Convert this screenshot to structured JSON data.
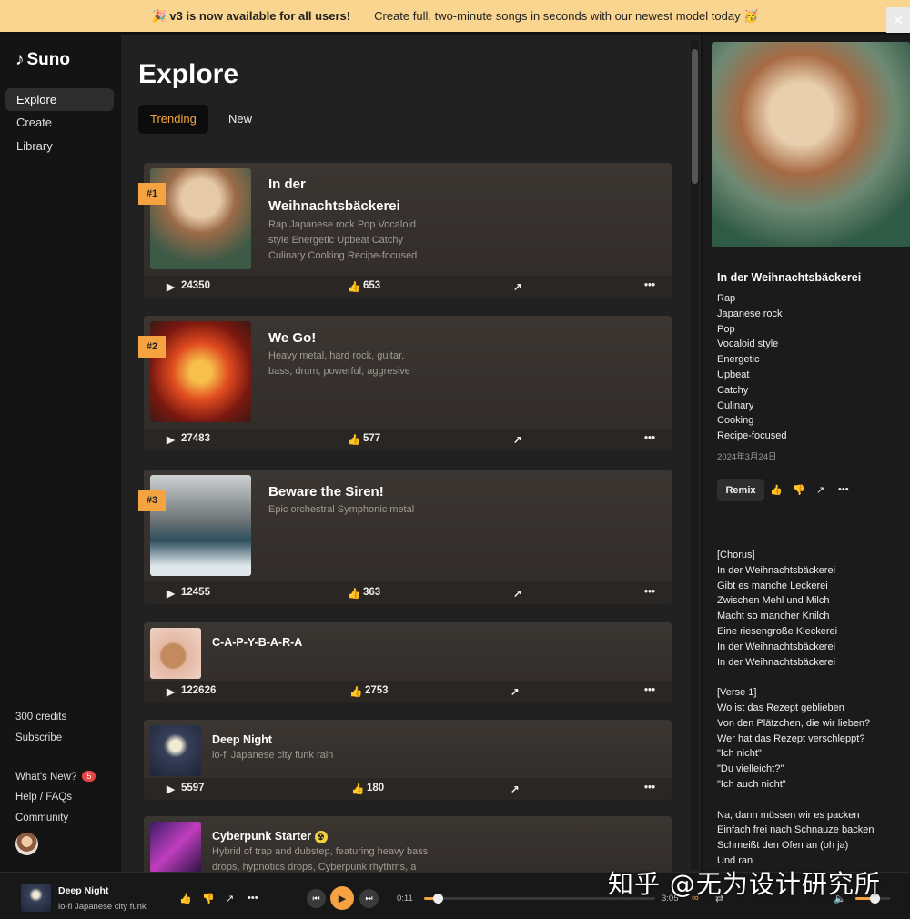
{
  "banner": {
    "headline": "v3 is now available for all users!",
    "text": "Create full, two-minute songs in seconds with our newest model today",
    "close": "✕"
  },
  "sidebar": {
    "logo": "Suno",
    "items": [
      {
        "label": "Explore",
        "active": true
      },
      {
        "label": "Create"
      },
      {
        "label": "Library"
      }
    ],
    "credits": "300 credits",
    "subscribe": "Subscribe",
    "whats_new": "What's New?",
    "whats_new_count": "5",
    "help": "Help / FAQs",
    "community": "Community"
  },
  "main": {
    "title": "Explore",
    "tabs": [
      "Trending",
      "New"
    ],
    "songs": [
      {
        "rank": "#1",
        "title": "In der Weihnachtsbäckerei",
        "desc": "Rap Japanese rock Pop Vocaloid style Energetic Upbeat Catchy Culinary Cooking Recipe-focused",
        "plays": "24350",
        "likes": "653"
      },
      {
        "rank": "#2",
        "title": "We Go!",
        "desc": "Heavy metal, hard rock, guitar, bass, drum, powerful, aggresive",
        "plays": "27483",
        "likes": "577"
      },
      {
        "rank": "#3",
        "title": "Beware the Siren!",
        "desc": "Epic orchestral Symphonic metal",
        "plays": "12455",
        "likes": "363"
      },
      {
        "title": "C-A-P-Y-B-A-R-A",
        "desc": "",
        "plays": "122626",
        "likes": "2753"
      },
      {
        "title": "Deep Night",
        "desc": "lo-fi Japanese city funk rain",
        "plays": "5597",
        "likes": "180"
      },
      {
        "title": "Cyberpunk Starter",
        "desc": "Hybrid of trap and dubstep, featuring heavy bass drops, hypnotics drops, Cyberpunk rhythms, a"
      }
    ]
  },
  "detail": {
    "title": "In der Weihnachtsbäckerei",
    "tags": [
      "Rap",
      "Japanese rock",
      "Pop",
      "Vocaloid style",
      "Energetic",
      "Upbeat",
      "Catchy",
      "Culinary",
      "Cooking",
      "Recipe-focused"
    ],
    "date": "2024年3月24日",
    "remix": "Remix",
    "lyrics": "[Chorus]\nIn der Weihnachtsbäckerei\nGibt es manche Leckerei\nZwischen Mehl und Milch\nMacht so mancher Knilch\nEine riesengroße Kleckerei\nIn der Weihnachtsbäckerei\nIn der Weihnachtsbäckerei\n\n[Verse 1]\nWo ist das Rezept geblieben\nVon den Plätzchen, die wir lieben?\nWer hat das Rezept verschleppt?\n\"Ich nicht\"\n\"Du vielleicht?\"\n\"Ich auch nicht\"\n\nNa, dann müssen wir es packen\nEinfach frei nach Schnauze backen\nSchmeißt den Ofen an (oh ja)\nUnd ran"
  },
  "player": {
    "title": "Deep Night",
    "desc": "lo-fi Japanese city funk",
    "elapsed": "0:11",
    "duration": "3:05",
    "progress": 0.06,
    "volume": 0.55
  },
  "watermark": "知乎 @无为设计研究所",
  "colors": {
    "accent": "#f4a340",
    "banner": "#f9d58f"
  }
}
